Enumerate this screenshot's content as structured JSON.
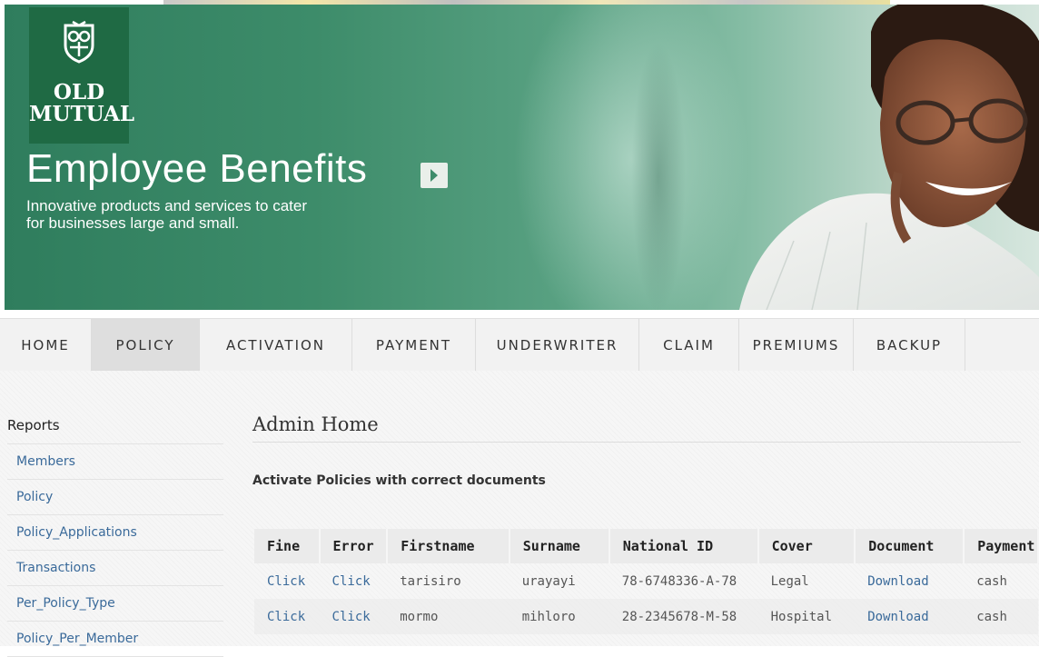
{
  "banner": {
    "logo_line1": "OLD",
    "logo_line2": "MUTUAL",
    "headline": "Employee Benefits",
    "subline1": "Innovative products and services to cater",
    "subline2": "for businesses large and small."
  },
  "nav": {
    "items": [
      "HOME",
      "POLICY",
      "ACTIVATION",
      "PAYMENT",
      "UNDERWRITER",
      "CLAIM",
      "PREMIUMS",
      "BACKUP"
    ],
    "active": "POLICY"
  },
  "sidebar": {
    "title": "Reports",
    "links": [
      "Members",
      "Policy",
      "Policy_Applications",
      "Transactions",
      "Per_Policy_Type",
      "Policy_Per_Member"
    ]
  },
  "main": {
    "title": "Admin Home",
    "section_title": "Activate Policies with correct documents",
    "table": {
      "headers": [
        "Fine",
        "Error",
        "Firstname",
        "Surname",
        "National ID",
        "Cover",
        "Document",
        "Payment"
      ],
      "rows": [
        {
          "fine": "Click",
          "error": "Click",
          "firstname": "tarisiro",
          "surname": "urayayi",
          "national_id": "78-6748336-A-78",
          "cover": "Legal",
          "document": "Download",
          "payment": "cash"
        },
        {
          "fine": "Click",
          "error": "Click",
          "firstname": "mormo",
          "surname": "mihloro",
          "national_id": "28-2345678-M-58",
          "cover": "Hospital",
          "document": "Download",
          "payment": "cash"
        }
      ]
    }
  },
  "colors": {
    "brand_green": "#1f6a44",
    "link_blue": "#3a6a9a",
    "nav_bg": "#f2f2f2"
  }
}
